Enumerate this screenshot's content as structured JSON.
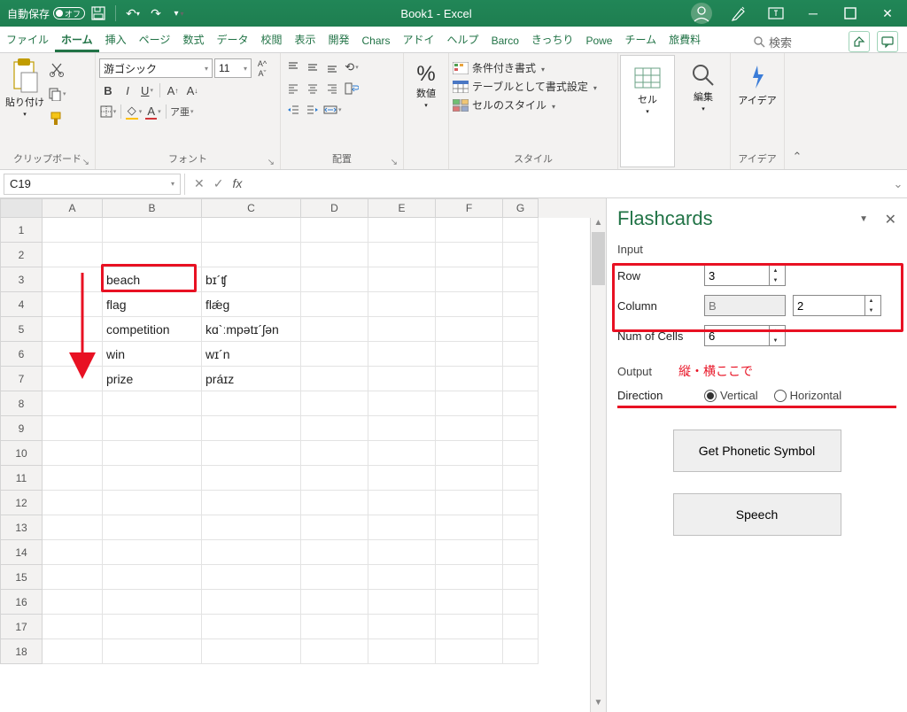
{
  "titlebar": {
    "autosave_label": "自動保存",
    "autosave_state": "オフ",
    "title": "Book1  -  Excel"
  },
  "tabs": {
    "items": [
      "ファイル",
      "ホーム",
      "挿入",
      "ページ",
      "数式",
      "データ",
      "校閲",
      "表示",
      "開発",
      "Chars",
      "アドイ",
      "ヘルプ",
      "Barco",
      "きっちり",
      "Powe",
      "チーム",
      "旅費料"
    ],
    "active_index": 1,
    "search_placeholder": "検索"
  },
  "ribbon": {
    "clipboard": {
      "paste": "貼り付け",
      "label": "クリップボード"
    },
    "font": {
      "name": "游ゴシック",
      "size": "11",
      "label": "フォント"
    },
    "alignment": {
      "label": "配置"
    },
    "number": {
      "btn": "数値",
      "label": ""
    },
    "styles": {
      "cond": "条件付き書式",
      "table": "テーブルとして書式設定",
      "cell": "セルのスタイル",
      "label": "スタイル"
    },
    "cells": {
      "btn": "セル"
    },
    "editing": {
      "btn": "編集"
    },
    "ideas": {
      "btn": "アイデア",
      "label": "アイデア"
    }
  },
  "formula_bar": {
    "name_box": "C19",
    "fx": "fx"
  },
  "grid": {
    "columns": [
      "",
      "A",
      "B",
      "C",
      "D",
      "E",
      "F",
      "G"
    ],
    "row_numbers": [
      1,
      2,
      3,
      4,
      5,
      6,
      7,
      8,
      9,
      10,
      11,
      12,
      13,
      14,
      15,
      16,
      17,
      18
    ],
    "data": {
      "3": {
        "B": "beach",
        "C": "bɪ´ʧ"
      },
      "4": {
        "B": "flag",
        "C": "flǽg"
      },
      "5": {
        "B": "competition",
        "C": "kɑ`ːmpətɪ´ʃən"
      },
      "6": {
        "B": "win",
        "C": "wɪ´n"
      },
      "7": {
        "B": "prize",
        "C": "práɪz"
      }
    }
  },
  "pane": {
    "title": "Flashcards",
    "input_label": "Input",
    "row_label": "Row",
    "row_value": "3",
    "col_label": "Column",
    "col_letter": "B",
    "col_value": "2",
    "numcells_label": "Num of Cells",
    "numcells_value": "6",
    "output_label": "Output",
    "annotation": "縦・横ここで",
    "direction_label": "Direction",
    "vertical": "Vertical",
    "horizontal": "Horizontal",
    "btn_phonetic": "Get Phonetic Symbol",
    "btn_speech": "Speech"
  }
}
